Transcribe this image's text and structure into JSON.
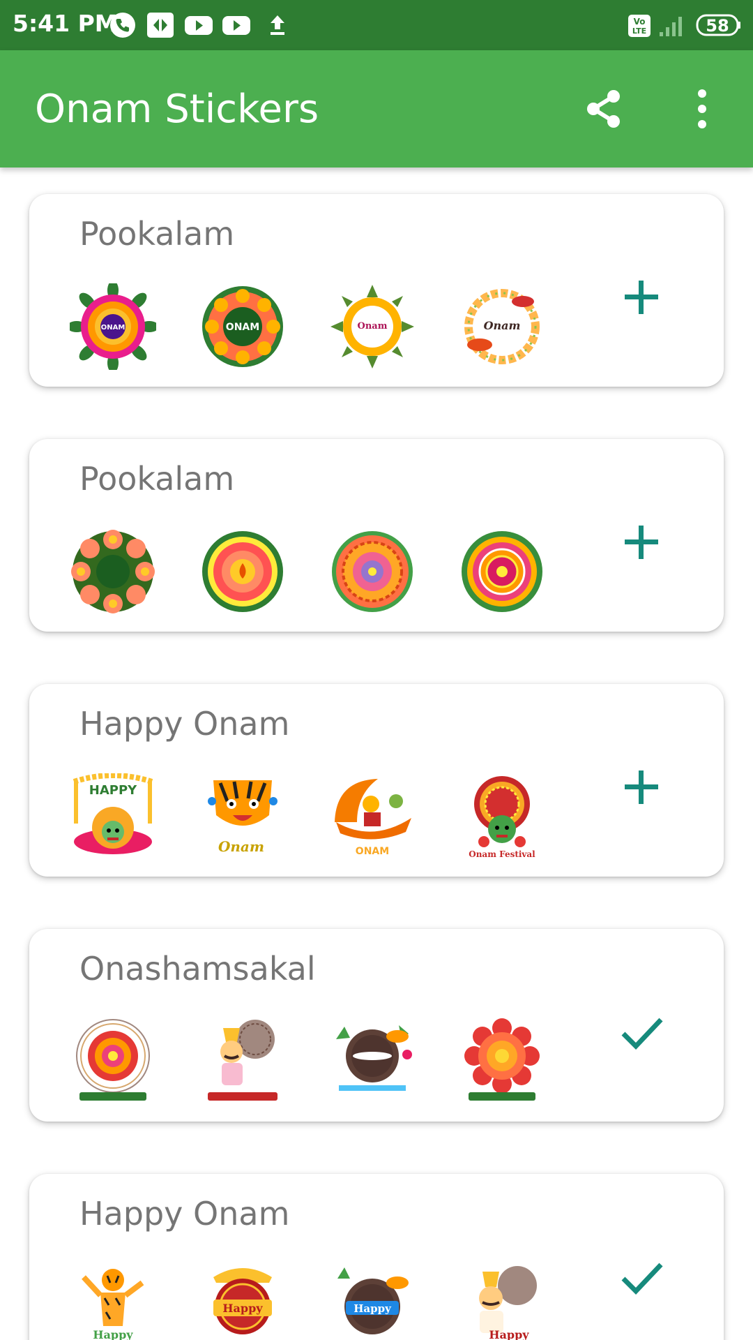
{
  "status_bar": {
    "time": "5:41 PM",
    "battery": "58",
    "network_label": "Vo LTE",
    "icons": [
      "phone-call-icon",
      "app-notification-icon",
      "youtube-icon",
      "youtube-icon",
      "upload-icon",
      "volte-icon",
      "signal-icon",
      "battery-icon"
    ]
  },
  "app_bar": {
    "title": "Onam Stickers",
    "actions": [
      "share-icon",
      "more-vert-icon"
    ]
  },
  "colors": {
    "status_bar": "#2e7d32",
    "app_bar": "#4caf50",
    "action_tint": "#168a7c",
    "card_title": "#757575"
  },
  "packs": [
    {
      "name": "Pookalam",
      "stickers": [
        "pookalam-happy-onam-sticker",
        "pookalam-onam-sticker",
        "pookalam-onam-festival-sticker",
        "onam-festival-wreath-sticker"
      ],
      "action": "add",
      "action_icon": "plus-icon"
    },
    {
      "name": "Pookalam",
      "stickers": [
        "pookalam-flower-sticker",
        "pookalam-lamp-sticker",
        "pookalam-mandala-sticker",
        "pookalam-pink-sticker"
      ],
      "action": "add",
      "action_icon": "plus-icon"
    },
    {
      "name": "Happy Onam",
      "stickers": [
        "happy-onam-kathakali-sticker",
        "happy-onam-tiger-sticker",
        "happy-onam-boat-sticker",
        "onam-festival-kathakali-sticker"
      ],
      "action": "add",
      "action_icon": "plus-icon"
    },
    {
      "name": "Onashamsakal",
      "stickers": [
        "onashamsakal-flower-sticker",
        "onashamsakal-maveli-sticker",
        "onashamsakal-pot-sticker",
        "onashamsakal-red-flower-sticker"
      ],
      "action": "added",
      "action_icon": "check-icon"
    },
    {
      "name": "Happy Onam",
      "stickers": [
        "happy-onam-puli-sticker",
        "happy-onam-umbrella-sticker",
        "happy-onam-boat-sticker",
        "happy-onam-maveli-sticker"
      ],
      "action": "added",
      "action_icon": "check-icon"
    }
  ]
}
